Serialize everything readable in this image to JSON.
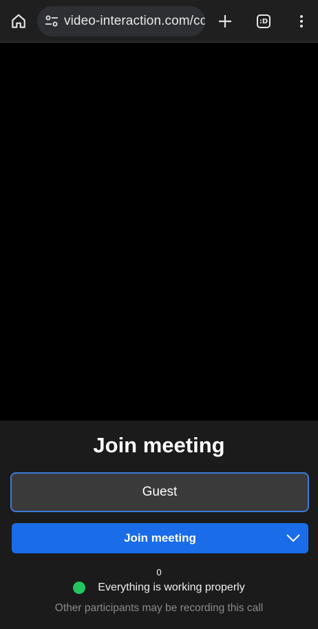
{
  "browser": {
    "url": "video-interaction.com/cc",
    "tab_switcher_label": ":D",
    "icons": {
      "home": "home-icon",
      "site_settings": "tune-icon",
      "new_tab": "plus-icon",
      "tabs": "tab-switcher-icon",
      "menu": "more-vert-icon"
    }
  },
  "join_panel": {
    "title": "Join meeting",
    "name_input_value": "Guest",
    "join_button_label": "Join meeting",
    "counter": "0",
    "status_text": "Everything is working properly",
    "status_color": "#22c55e",
    "recording_notice": "Other participants may be recording this call"
  },
  "colors": {
    "accent": "#1a6ce8",
    "input_border": "#3e7bd6",
    "panel_bg": "#1b1b1b",
    "toolbar_bg": "#1f1f1f"
  }
}
